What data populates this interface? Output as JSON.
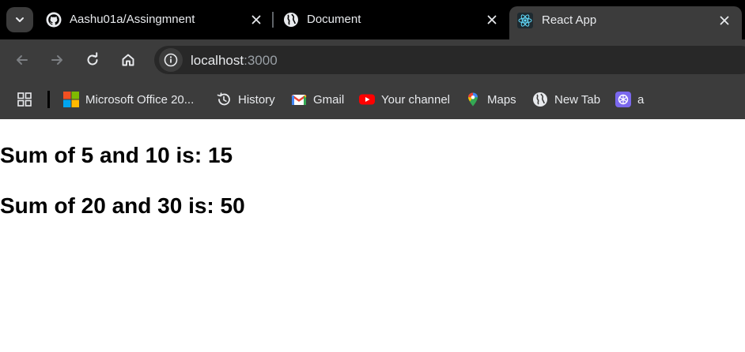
{
  "browser": {
    "tabs": [
      {
        "title": "Aashu01a/Assingmnent",
        "icon": "github-icon"
      },
      {
        "title": "Document",
        "icon": "globe-icon"
      },
      {
        "title": "React App",
        "icon": "react-icon",
        "active": true
      }
    ],
    "address_bar": {
      "host": "localhost",
      "port": ":3000"
    },
    "bookmarks": [
      {
        "label": "Microsoft Office 20...",
        "icon": "microsoft-office-icon"
      },
      {
        "label": "History",
        "icon": "history-icon"
      },
      {
        "label": "Gmail",
        "icon": "gmail-icon"
      },
      {
        "label": "Your channel",
        "icon": "youtube-icon"
      },
      {
        "label": "Maps",
        "icon": "maps-icon"
      },
      {
        "label": "New Tab",
        "icon": "globe-icon"
      },
      {
        "label": "a",
        "icon": "chatgpt-icon"
      }
    ]
  },
  "page": {
    "lines": [
      "Sum of 5 and 10 is: 15",
      "Sum of 20 and 30 is: 50"
    ]
  },
  "colors": {
    "tabstrip_bg": "#000000",
    "toolbar_bg": "#3c3c3c",
    "omnibox_bg": "#282828",
    "text_light": "#e8eaed",
    "text_dim": "#9aa0a6"
  }
}
